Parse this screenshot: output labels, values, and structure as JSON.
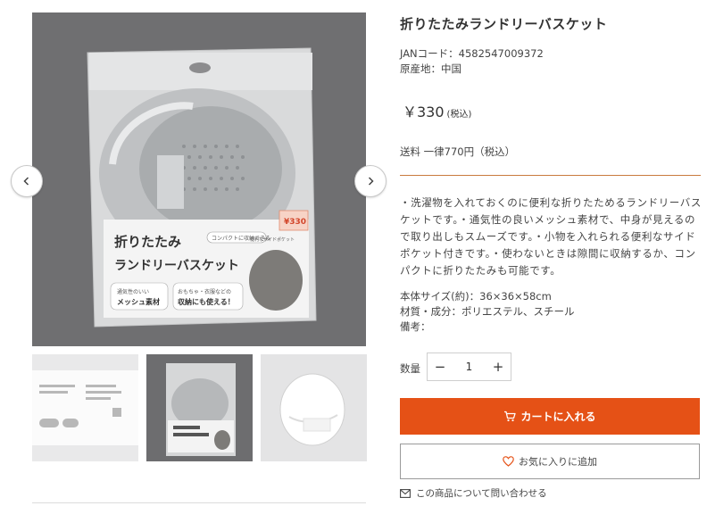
{
  "product": {
    "title": "折りたたみランドリーバスケット",
    "jan": "JANコード：4582547009372",
    "origin": "原産地：中国",
    "price": "￥330",
    "price_tax": "(税込)",
    "shipping": "送料 一律770円（税込）",
    "description": "・洗濯物を入れておくのに便利な折りたためるランドリーバスケットです。・通気性の良いメッシュ素材で、中身が見えるので取り出しもスムーズです。・小物を入れられる便利なサイドポケット付きです。・使わないときは隙間に収納するか、コンパクトに折りたたみも可能です。",
    "spec_size": "本体サイズ(約)：36×36×58cm",
    "spec_material": "材質・成分：ポリエステル、スチール",
    "spec_note": "備考："
  },
  "package": {
    "line1": "折りたたみ",
    "line2": "ランドリーバスケット",
    "tag": "コンパクトに収納できる",
    "badge1": "通気性のいい",
    "badge1b": "メッシュ素材",
    "badge2": "おもちゃ・衣服などの",
    "badge2b": "収納にも使える！",
    "side": "便利なサイドポケット",
    "price_sticker": "¥330"
  },
  "quantity": {
    "label": "数量",
    "value": "1",
    "minus": "−",
    "plus": "+"
  },
  "actions": {
    "cart": "カートに入れる",
    "favorite": "お気に入りに追加",
    "inquiry": "この商品について問い合わせる"
  },
  "colors": {
    "accent": "#e55116",
    "rule": "#c97a3d",
    "image_bg": "#6f6f71"
  },
  "icons": [
    "chevron-left-icon",
    "chevron-right-icon",
    "cart-icon",
    "heart-icon",
    "mail-icon"
  ]
}
